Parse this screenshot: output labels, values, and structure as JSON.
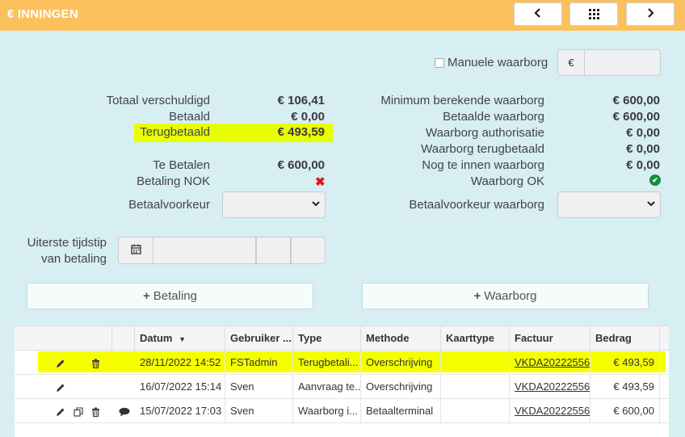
{
  "header": {
    "title": "€ INNINGEN",
    "prev_icon": "chevron-left-icon",
    "grid_icon": "grid-icon",
    "next_icon": "chevron-right-icon"
  },
  "manual_deposit": {
    "label": "Manuele waarborg",
    "currency": "€",
    "value": ""
  },
  "left": {
    "rows": [
      {
        "label": "Totaal verschuldigd",
        "value": "€ 106,41"
      },
      {
        "label": "Betaald",
        "value": "€ 0,00"
      },
      {
        "label": "Terugbetaald",
        "value": "€ 493,59"
      },
      {
        "label": "Te Betalen",
        "value": "€ 600,00"
      },
      {
        "label": "Betaling NOK",
        "value": "✖"
      }
    ],
    "payment_pref_label": "Betaalvoorkeur",
    "deadline_label_1": "Uiterste tijdstip",
    "deadline_label_2": "van betaling"
  },
  "right": {
    "rows": [
      {
        "label": "Minimum berekende waarborg",
        "value": "€ 600,00"
      },
      {
        "label": "Betaalde waarborg",
        "value": "€ 600,00"
      },
      {
        "label": "Waarborg authorisatie",
        "value": "€ 0,00"
      },
      {
        "label": "Waarborg terugbetaald",
        "value": "€ 0,00"
      },
      {
        "label": "Nog te innen waarborg",
        "value": "€ 0,00"
      },
      {
        "label": "Waarborg OK",
        "value": "✔"
      }
    ],
    "payment_pref_label": "Betaalvoorkeur waarborg"
  },
  "buttons": {
    "payment": "Betaling",
    "deposit": "Waarborg"
  },
  "table": {
    "columns": [
      "Datum",
      "Gebruiker ...",
      "Type",
      "Methode",
      "Kaarttype",
      "Factuur",
      "Bedrag"
    ],
    "sort_icon": "caret-down-icon",
    "rows": [
      {
        "date": "28/11/2022 14:52",
        "user": "FSTadmin",
        "type": "Terugbetali...",
        "method": "Overschrijving",
        "card": "",
        "invoice": "VKDA20222556",
        "amount": "€ 493,59"
      },
      {
        "date": "16/07/2022 15:14",
        "user": "Sven",
        "type": "Aanvraag te...",
        "method": "Overschrijving",
        "card": "",
        "invoice": "VKDA20222556",
        "amount": "€ 493,59"
      },
      {
        "date": "15/07/2022 17:03",
        "user": "Sven",
        "type": "Waarborg i...",
        "method": "Betaalterminal",
        "card": "",
        "invoice": "VKDA20222556",
        "amount": "€ 600,00"
      }
    ]
  },
  "colors": {
    "header": "#fcc15d",
    "background": "#d7eef2",
    "highlight": "#e8ff00",
    "error": "#e0141e",
    "ok": "#1a8c3a"
  }
}
